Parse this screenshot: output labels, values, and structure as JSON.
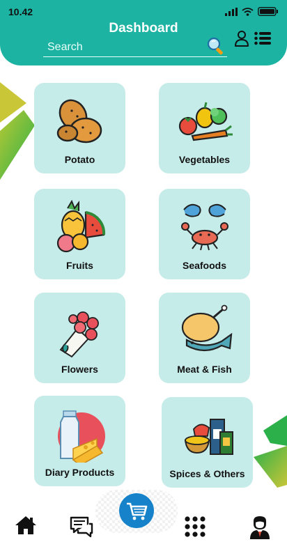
{
  "status": {
    "time": "10.42"
  },
  "header": {
    "title": "Dashboard"
  },
  "search": {
    "placeholder": "Search"
  },
  "categories": [
    {
      "label": "Potato"
    },
    {
      "label": "Vegetables"
    },
    {
      "label": "Fruits"
    },
    {
      "label": "Seafoods"
    },
    {
      "label": "Flowers"
    },
    {
      "label": "Meat & Fish"
    },
    {
      "label": "Diary Products"
    },
    {
      "label": "Spices & Others"
    }
  ],
  "nav": {
    "items": [
      "home-icon",
      "chat-icon",
      "cart-icon",
      "grid-menu-icon",
      "profile-icon"
    ]
  },
  "colors": {
    "header": "#1cb3a2",
    "card": "#c6ecea",
    "cart_button": "#1582c9",
    "stripe_green": "#3cb043"
  }
}
